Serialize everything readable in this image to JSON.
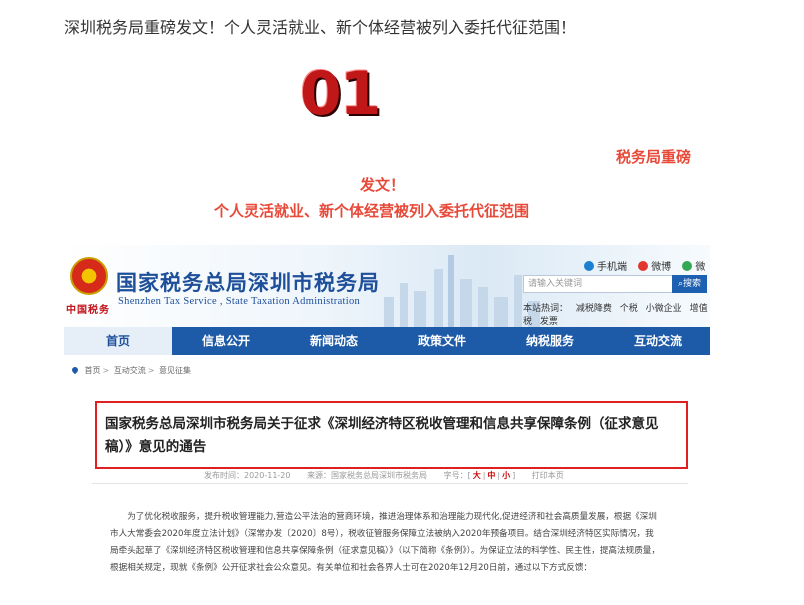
{
  "headline": "深圳税务局重磅发文！个人灵活就业、新个体经营被列入委托代征范围！",
  "big_number": "01",
  "red_lines": [
    "税务局重磅",
    "发文！",
    "个人灵活就业、新个体经营被列入委托代征范围"
  ],
  "site": {
    "emblem_text": "中国税务",
    "title": "国家税务总局深圳市税务局",
    "subtitle": "Shenzhen Tax Service , State Taxation Administration",
    "top_links": [
      {
        "icon": "mobile-icon",
        "label": "手机端",
        "color": "#1d7fd0"
      },
      {
        "icon": "weibo-icon",
        "label": "微博",
        "color": "#e0362f"
      },
      {
        "icon": "wechat-icon",
        "label": "微信",
        "color": "#33a852"
      }
    ],
    "search": {
      "placeholder": "请输入关键词",
      "button": "搜索"
    },
    "hot_label": "本站热词：",
    "hot_words": [
      "减税降费",
      "个税",
      "小微企业",
      "增值税",
      "发票"
    ],
    "nav": [
      "首页",
      "信息公开",
      "新闻动态",
      "政策文件",
      "纳税服务",
      "互动交流"
    ],
    "breadcrumb": [
      "首页",
      "互动交流",
      "意见征集"
    ],
    "article": {
      "title": "国家税务总局深圳市税务局关于征求《深圳经济特区税收管理和信息共享保障条例（征求意见稿）》意见的通告",
      "date": "发布时间：2020-11-20",
      "source": "来源：国家税务总局深圳市税务局",
      "size_label": "字号：",
      "sizes": [
        "大",
        "中",
        "小"
      ],
      "print": "打印本页",
      "paragraphs": [
        "为了优化税收服务，提升税收管理能力,营造公平法治的营商环境，推进治理体系和治理能力现代化,促进经济和社会高质量发展，根据《深圳市人大常委会2020年度立法计划》（深常办发〔2020〕8号），税收征管服务保障立法被纳入2020年预备项目。结合深圳经济特区实际情况，我局牵头起草了《深圳经济特区税收管理和信息共享保障条例（征求意见稿）》（以下简称《条例》）。为保证立法的科学性、民主性，提高法规质量，根据相关规定，现就《条例》公开征求社会公众意见。有关单位和社会各界人士可在2020年12月20日前，通过以下方式反馈："
      ]
    }
  },
  "colors": {
    "brand_blue": "#1d5aa8",
    "accent_red": "#e84a3a",
    "box_red": "#e02020"
  }
}
